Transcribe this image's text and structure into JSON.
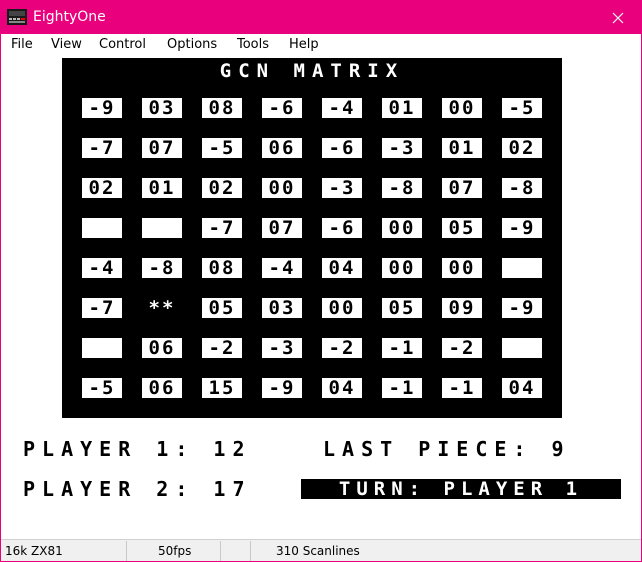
{
  "window": {
    "title": "EightyOne"
  },
  "menu": [
    "File",
    "View",
    "Control",
    "Options",
    "Tools",
    "Help"
  ],
  "board": {
    "title": "GCN MATRIX",
    "rows": [
      [
        "-9",
        "03",
        "08",
        "-6",
        "-4",
        "01",
        "00",
        "-5"
      ],
      [
        "-7",
        "07",
        "-5",
        "06",
        "-6",
        "-3",
        "01",
        "02"
      ],
      [
        "02",
        "01",
        "02",
        "00",
        "-3",
        "-8",
        "07",
        "-8"
      ],
      [
        "",
        "",
        "-7",
        "07",
        "-6",
        "00",
        "05",
        "-9"
      ],
      [
        "-4",
        "-8",
        "08",
        "-4",
        "04",
        "00",
        "00",
        ""
      ],
      [
        "-7",
        "**",
        "05",
        "03",
        "00",
        "05",
        "09",
        "-9"
      ],
      [
        "",
        "06",
        "-2",
        "-3",
        "-2",
        "-1",
        "-2",
        ""
      ],
      [
        "-5",
        "06",
        "15",
        "-9",
        "04",
        "-1",
        "-1",
        "04"
      ]
    ],
    "cursor": {
      "row": 5,
      "col": 1
    }
  },
  "status": {
    "player1_label": "PLAYER 1:",
    "player1_score": "12",
    "player2_label": "PLAYER 2:",
    "player2_score": "17",
    "last_piece_label": "LAST PIECE:",
    "last_piece_value": "9",
    "turn": "TURN: PLAYER 1"
  },
  "statusbar": {
    "machine": "16k ZX81",
    "fps": "50fps",
    "blank": "",
    "scanlines": "310 Scanlines"
  }
}
